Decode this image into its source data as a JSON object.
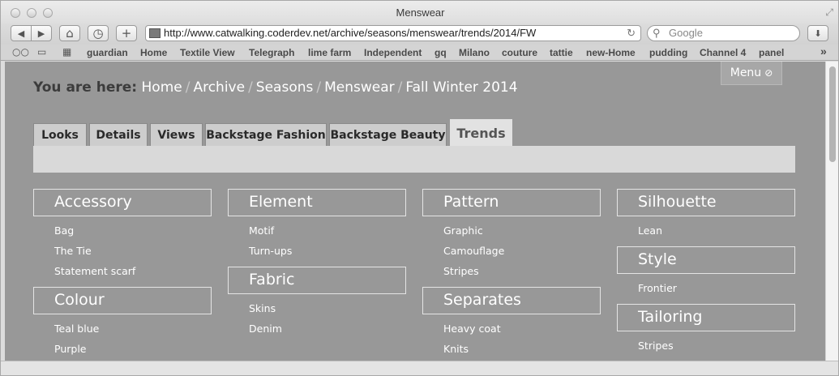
{
  "window": {
    "title": "Menswear"
  },
  "toolbar": {
    "back_icon": "◀",
    "forward_icon": "▶",
    "home_icon": "⌂",
    "history_icon": "◷",
    "add_icon": "+",
    "url": "http://www.catwalking.coderdev.net/archive/seasons/menswear/trends/2014/FW",
    "reload_icon": "↻",
    "search_placeholder": "Google",
    "search_icon": "⚲",
    "download_icon": "⬇"
  },
  "bookmarks": {
    "items": [
      "guardian",
      "Home",
      "Textile View",
      "Telegraph",
      "lime farm",
      "Independent",
      "gq",
      "Milano",
      "couture",
      "tattie",
      "new-Home",
      "pudding",
      "Channel 4",
      "panel"
    ],
    "overflow_icon": "»"
  },
  "page": {
    "breadcrumb": {
      "prefix": "You are here:",
      "items": [
        "Home",
        "Archive",
        "Seasons",
        "Menswear",
        "Fall Winter 2014"
      ],
      "separator": "/"
    },
    "menu_label": "Menu",
    "menu_icon": "⊘",
    "tabs": [
      "Looks",
      "Details",
      "Views",
      "Backstage Fashion",
      "Backstage Beauty",
      "Trends"
    ],
    "active_tab": "Trends",
    "categories": [
      {
        "title": "Accessory",
        "items": [
          "Bag",
          "The Tie",
          "Statement scarf"
        ]
      },
      {
        "title": "Colour",
        "items": [
          "Teal blue",
          "Purple"
        ]
      },
      {
        "title": "Element",
        "items": [
          "Motif",
          "Turn-ups"
        ]
      },
      {
        "title": "Fabric",
        "items": [
          "Skins",
          "Denim"
        ]
      },
      {
        "title": "Pattern",
        "items": [
          "Graphic",
          "Camouflage",
          "Stripes"
        ]
      },
      {
        "title": "Separates",
        "items": [
          "Heavy coat",
          "Knits"
        ]
      },
      {
        "title": "Silhouette",
        "items": [
          "Lean"
        ]
      },
      {
        "title": "Style",
        "items": [
          "Frontier"
        ]
      },
      {
        "title": "Tailoring",
        "items": [
          "Stripes"
        ]
      }
    ]
  },
  "colors": {
    "page_background": "#989898",
    "text_light": "#ffffff",
    "breadcrumb_prefix": "#3c3c3c"
  }
}
